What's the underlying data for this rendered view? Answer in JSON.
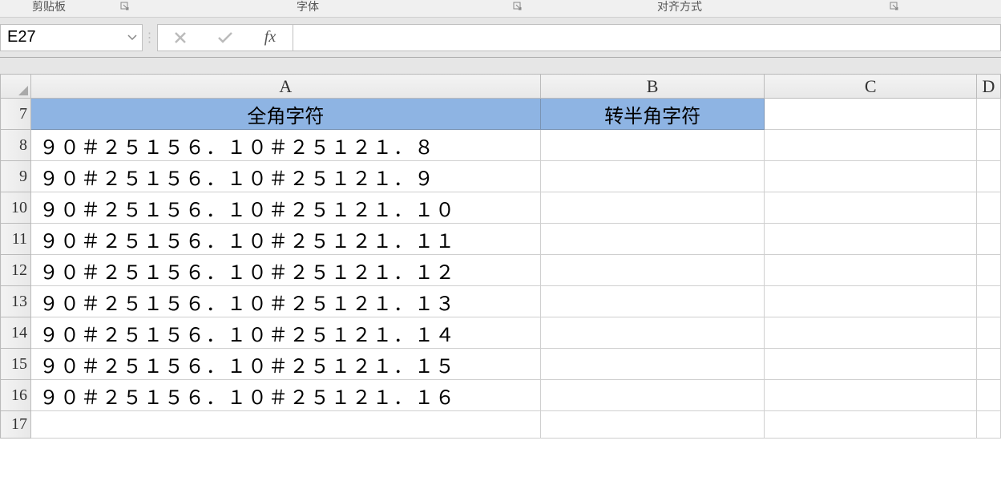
{
  "ribbon": {
    "clipboard_label": "剪贴板",
    "font_label": "字体",
    "align_label": "对齐方式"
  },
  "formula_bar": {
    "name_box_value": "E27",
    "cancel": "✕",
    "confirm": "✓",
    "fx_label": "fx",
    "formula_value": ""
  },
  "columns": {
    "A": "A",
    "B": "B",
    "C": "C",
    "D": "D"
  },
  "rows": {
    "r7": "7",
    "r8": "8",
    "r9": "9",
    "r10": "10",
    "r11": "11",
    "r12": "12",
    "r13": "13",
    "r14": "14",
    "r15": "15",
    "r16": "16",
    "r17": "17"
  },
  "headers": {
    "A": "全角字符",
    "B": "转半角字符"
  },
  "data": {
    "A8": "９０＃２５１５６．１０＃２５１２１．８",
    "A9": "９０＃２５１５６．１０＃２５１２１．９",
    "A10": "９０＃２５１５６．１０＃２５１２１．１０",
    "A11": "９０＃２５１５６．１０＃２５１２１．１１",
    "A12": "９０＃２５１５６．１０＃２５１２１．１２",
    "A13": "９０＃２５１５６．１０＃２５１２１．１３",
    "A14": "９０＃２５１５６．１０＃２５１２１．１４",
    "A15": "９０＃２５１５６．１０＃２５１２１．１５",
    "A16": "９０＃２５１５６．１０＃２５１２１．１６",
    "B8": "",
    "B9": "",
    "B10": "",
    "B11": "",
    "B12": "",
    "B13": "",
    "B14": "",
    "B15": "",
    "B16": ""
  }
}
